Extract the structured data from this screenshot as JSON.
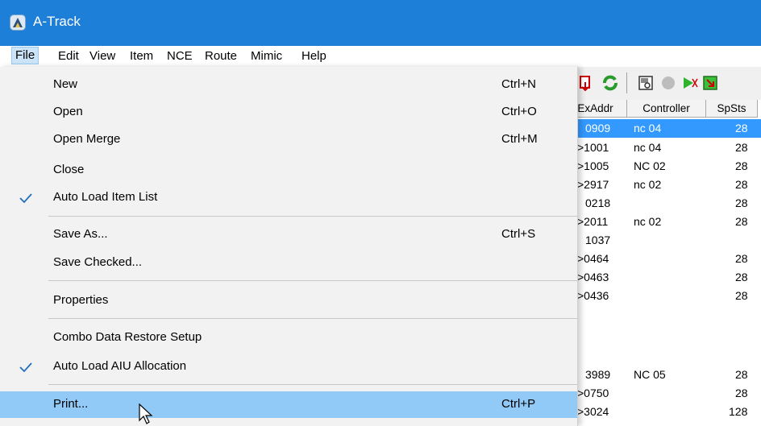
{
  "window": {
    "title": "A-Track"
  },
  "menubar": {
    "items": [
      {
        "label": "File"
      },
      {
        "label": "Edit"
      },
      {
        "label": "View"
      },
      {
        "label": "Item"
      },
      {
        "label": "NCE"
      },
      {
        "label": "Route"
      },
      {
        "label": "Mimic"
      },
      {
        "label": "Help"
      }
    ]
  },
  "file_menu": {
    "items": [
      {
        "label": "New",
        "shortcut": "Ctrl+N"
      },
      {
        "label": "Open",
        "shortcut": "Ctrl+O"
      },
      {
        "label": "Open Merge",
        "shortcut": "Ctrl+M"
      },
      {
        "label": "Close",
        "shortcut": ""
      },
      {
        "label": "Auto Load Item List",
        "shortcut": "",
        "checked": true
      },
      {
        "label": "Save As...",
        "shortcut": "Ctrl+S"
      },
      {
        "label": "Save Checked...",
        "shortcut": ""
      },
      {
        "label": "Properties",
        "shortcut": ""
      },
      {
        "label": "Combo Data Restore Setup",
        "shortcut": ""
      },
      {
        "label": "Auto Load AIU Allocation",
        "shortcut": "",
        "checked": true
      },
      {
        "label": "Print...",
        "shortcut": "Ctrl+P",
        "highlighted": true
      }
    ]
  },
  "grid": {
    "columns": [
      "ExAddr",
      "Controller",
      "SpSts"
    ],
    "rows": [
      {
        "exaddr": "0909",
        "controller": "nc 04",
        "spsts": "28",
        "selected": true
      },
      {
        "exaddr": ">1001",
        "controller": "nc 04",
        "spsts": "28"
      },
      {
        "exaddr": ">1005",
        "controller": "NC 02",
        "spsts": "28"
      },
      {
        "exaddr": ">2917",
        "controller": "nc 02",
        "spsts": "28"
      },
      {
        "exaddr": "0218",
        "controller": "",
        "spsts": "28"
      },
      {
        "exaddr": ">2011",
        "controller": "nc 02",
        "spsts": "28"
      },
      {
        "exaddr": "1037",
        "controller": "",
        "spsts": ""
      },
      {
        "exaddr": ">0464",
        "controller": "",
        "spsts": "28"
      },
      {
        "exaddr": ">0463",
        "controller": "",
        "spsts": "28"
      },
      {
        "exaddr": ">0436",
        "controller": "",
        "spsts": "28"
      },
      {
        "exaddr": "",
        "controller": "",
        "spsts": ""
      },
      {
        "exaddr": "3989",
        "controller": "NC 05",
        "spsts": "28"
      },
      {
        "exaddr": ">0750",
        "controller": "",
        "spsts": "28"
      },
      {
        "exaddr": ">3024",
        "controller": "",
        "spsts": "128"
      }
    ]
  },
  "toolbar": {
    "icons": [
      "red-copy-icon",
      "green-refresh-icon",
      "properties-icon",
      "gray-stop-icon",
      "green-flag-icon",
      "green-exit-icon"
    ]
  },
  "colors": {
    "titlebar": "#1e7fd8",
    "hover": "#91c9f7",
    "selected_row": "#3399ff"
  }
}
